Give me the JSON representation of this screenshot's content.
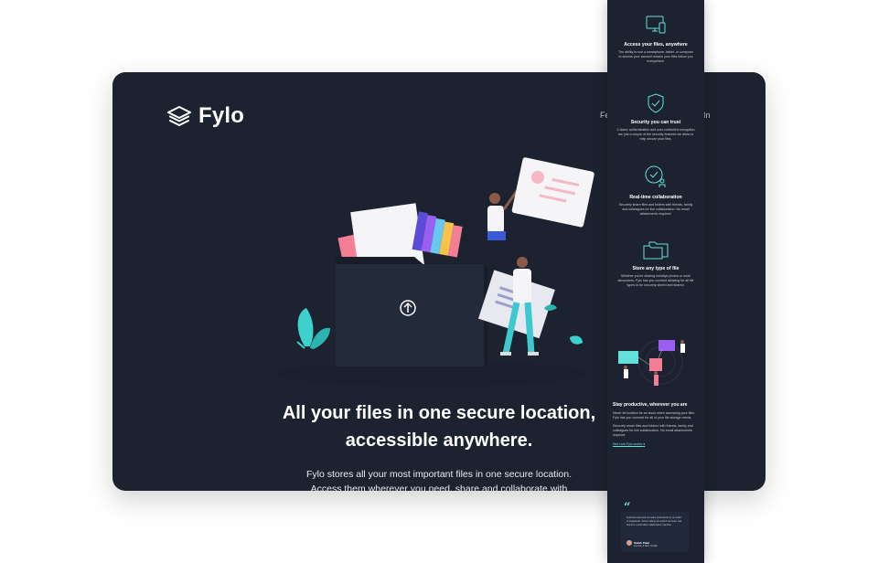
{
  "brand": {
    "name": "Fylo"
  },
  "nav": {
    "items": [
      "Fe",
      "n In"
    ]
  },
  "hero": {
    "title_line1": "All your files in one secure location,",
    "title_line2": "accessible anywhere.",
    "subtitle_line1": "Fylo stores all your most important files in one secure location.",
    "subtitle_line2": "Access them wherever you need, share and collaborate with"
  },
  "features": [
    {
      "icon": "devices-icon",
      "title": "Access your files, anywhere",
      "text": "The ability to use a smartphone, tablet, or computer to access your account means your files follow you everywhere."
    },
    {
      "icon": "shield-icon",
      "title": "Security you can trust",
      "text": "2-factor authentication and user-controlled encryption are just a couple of the security features we allow to help secure your files."
    },
    {
      "icon": "collaboration-icon",
      "title": "Real-time collaboration",
      "text": "Securely share files and folders with friends, family and colleagues for live collaboration. No email attachments required."
    },
    {
      "icon": "folders-icon",
      "title": "Store any type of file",
      "text": "Whether you're sharing holidays photos or work documents, Fylo has you covered allowing for all file types to be securely stored and shared."
    }
  ],
  "productive": {
    "title": "Stay productive, wherever you are",
    "text1": "Never let location be an issue when accessing your files. Fylo has you covered for all of your file storage needs.",
    "text2": "Securely share files and folders with friends, family and colleagues for live collaboration. No email attachments required.",
    "link": "See how Fylo works"
  },
  "testimonial": {
    "quote": "Fylo has improved our team productivity by an order of magnitude. Since making the switch our team has become a well-oiled collaboration machine.",
    "name": "Satish Patel",
    "role": "Founder & CEO, Huddle"
  },
  "colors": {
    "bg": "#1c2230",
    "accent": "#62e0d9",
    "panel": "#21293a"
  }
}
